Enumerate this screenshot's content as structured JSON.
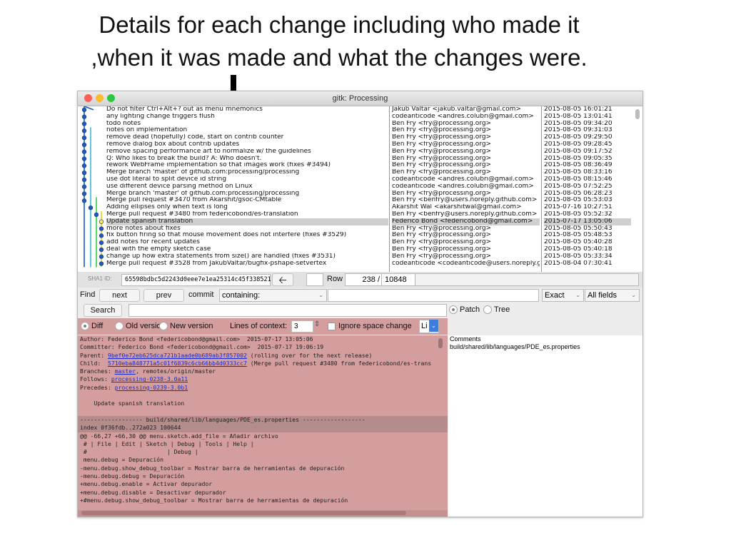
{
  "caption": {
    "line1": "Details for each change including who made it",
    "line2": ",when it was made and what the changes were."
  },
  "window": {
    "title": "gitk: Processing"
  },
  "commits": [
    {
      "msg": "Do not filter Ctrl+Alt+? out as menu mnemonics",
      "author": "Jakub Valtar <jakub.valtar@gmail.com>",
      "date": "2015-08-05 16:01:21"
    },
    {
      "msg": "any lighting change triggers flush",
      "author": "codeanticode <andres.colubri@gmail.com>",
      "date": "2015-08-05 13:01:41"
    },
    {
      "msg": "todo notes",
      "author": "Ben Fry <fry@processing.org>",
      "date": "2015-08-05 09:34:20"
    },
    {
      "msg": "notes on implementation",
      "author": "Ben Fry <fry@processing.org>",
      "date": "2015-08-05 09:31:03"
    },
    {
      "msg": "remove dead (hopefully) code, start on contrib counter",
      "author": "Ben Fry <fry@processing.org>",
      "date": "2015-08-05 09:29:50"
    },
    {
      "msg": "remove dialog box about contrib updates",
      "author": "Ben Fry <fry@processing.org>",
      "date": "2015-08-05 09:28:45"
    },
    {
      "msg": "remove spacing performance art to normalize w/ the guidelines",
      "author": "Ben Fry <fry@processing.org>",
      "date": "2015-08-05 09:17:52"
    },
    {
      "msg": "Q: Who likes to break the build? A: Who doesn't.",
      "author": "Ben Fry <fry@processing.org>",
      "date": "2015-08-05 09:05:35"
    },
    {
      "msg": "rework WebFrame implementation so that images work (fixes #3494)",
      "author": "Ben Fry <fry@processing.org>",
      "date": "2015-08-05 08:36:49"
    },
    {
      "msg": "Merge branch 'master' of github.com:processing/processing",
      "author": "Ben Fry <fry@processing.org>",
      "date": "2015-08-05 08:33:16"
    },
    {
      "msg": "use dot literal to split device id string",
      "author": "codeanticode <andres.colubri@gmail.com>",
      "date": "2015-08-05 08:15:46"
    },
    {
      "msg": "use different device parsing method on Linux",
      "author": "codeanticode <andres.colubri@gmail.com>",
      "date": "2015-08-05 07:52:25"
    },
    {
      "msg": "Merge branch 'master' of github.com:processing/processing",
      "author": "Ben Fry <fry@processing.org>",
      "date": "2015-08-05 06:28:23"
    },
    {
      "msg": "Merge pull request #3470 from Akarshit/gsoc-CMtable",
      "author": "Ben Fry <benfry@users.noreply.github.com>",
      "date": "2015-08-05 05:53:03"
    },
    {
      "msg": "  Adding ellipses only when text is long",
      "author": "Akarshit Wal <akarshitwal@gmail.com>",
      "date": "2015-07-16 10:27:51"
    },
    {
      "msg": "    Merge pull request #3480 from federicobond/es-translation",
      "author": "Ben Fry <benfry@users.noreply.github.com>",
      "date": "2015-08-05 05:52:32"
    },
    {
      "msg": "    Update spanish translation",
      "author": "Federico Bond <federicobond@gmail.com>",
      "date": "2015-07-17 13:05:06",
      "selected": true
    },
    {
      "msg": "    more notes about fixes",
      "author": "Ben Fry <fry@processing.org>",
      "date": "2015-08-05 05:50:43"
    },
    {
      "msg": "    fix button firing so that mouse movement does not interfere (fixes #3529)",
      "author": "Ben Fry <fry@processing.org>",
      "date": "2015-08-05 05:48:53"
    },
    {
      "msg": "    add notes for recent updates",
      "author": "Ben Fry <fry@processing.org>",
      "date": "2015-08-05 05:40:28"
    },
    {
      "msg": "    deal with the empty sketch case",
      "author": "Ben Fry <fry@processing.org>",
      "date": "2015-08-05 05:40:18"
    },
    {
      "msg": "    change up how extra statements from size() are handled (fixes #3531)",
      "author": "Ben Fry <fry@processing.org>",
      "date": "2015-08-05 05:33:34"
    },
    {
      "msg": "    Merge pull request #3528 from JakubValtar/bugfix-pshape-setvertex",
      "author": "codeanticode <codeanticode@users.noreply.github",
      "date": "2015-08-04 07:30:41"
    }
  ],
  "sha_bar": {
    "label": "SHA1 ID:",
    "value": "65598bdbc5d2243d0eee7e1ea25314c45f338521",
    "row_label": "Row",
    "row_current": "238 /",
    "row_total": "10848"
  },
  "find_bar": {
    "find_label": "Find",
    "next": "next",
    "prev": "prev",
    "commit_label": "commit",
    "containing": "containing:",
    "exact": "Exact",
    "all_fields": "All fields"
  },
  "search": {
    "button": "Search"
  },
  "view_tabs": {
    "patch": "Patch",
    "tree": "Tree"
  },
  "diff_opts": {
    "diff": "Diff",
    "old": "Old version",
    "new": "New version",
    "context_label": "Lines of context:",
    "context_value": "3",
    "ignore_space": "Ignore space change",
    "li": "Li"
  },
  "diff_lines": [
    {
      "t": "Author: Federico Bond <federicobond@gmail.com>  2015-07-17 13:05:06",
      "c": ""
    },
    {
      "t": "Committer: Federico Bond <federicobond@gmail.com>  2015-07-17 19:06:19",
      "c": ""
    },
    {
      "t": "Parent: 9bef0e72eb625dca721b1aade0b689ab3f857002 (rolling over for the next release)",
      "c": ""
    },
    {
      "t": "Child:  5710eba848771a5c01f6839c6cb66bb4d0333cc7 (Merge pull request #3480 from federicobond/es-trans",
      "c": ""
    },
    {
      "t": "Branches: master, remotes/origin/master",
      "c": ""
    },
    {
      "t": "Follows: processing-0238-3.0a11",
      "c": ""
    },
    {
      "t": "Precedes: processing-0239-3.0b1",
      "c": ""
    },
    {
      "t": "",
      "c": ""
    },
    {
      "t": "    Update spanish translation",
      "c": ""
    },
    {
      "t": "",
      "c": ""
    },
    {
      "t": "------------------ build/shared/lib/languages/PDE_es.properties ------------------",
      "c": "hdr"
    },
    {
      "t": "index 0f36fdb..272a023 100644",
      "c": "hdr"
    },
    {
      "t": "@@ -66,27 +66,30 @@ menu.sketch.add_file = Añadir archivo",
      "c": "hunk"
    },
    {
      "t": " # | File | Edit | Sketch | Debug | Tools | Help |",
      "c": ""
    },
    {
      "t": " #                       | Debug |",
      "c": ""
    },
    {
      "t": " menu.debug = Depuración",
      "c": ""
    },
    {
      "t": "-menu.debug.show_debug_toolbar = Mostrar barra de herramientas de depuración",
      "c": "rm"
    },
    {
      "t": "-menu.debug.debug = Depuración",
      "c": "rm"
    },
    {
      "t": "+menu.debug.enable = Activar depurador",
      "c": "add"
    },
    {
      "t": "+menu.debug.disable = Desactivar depurador",
      "c": "add"
    },
    {
      "t": "+#menu.debug.show_debug_toolbar = Mostrar barra de herramientas de depuración",
      "c": "add"
    }
  ],
  "files": {
    "header": "Comments",
    "items": [
      "build/shared/lib/languages/PDE_es.properties"
    ]
  },
  "graph_colors": [
    "#1d5bc2",
    "#3cb7d8",
    "#2ecc40",
    "#e6d21d",
    "#d7d7d7",
    "#8a2be2"
  ]
}
